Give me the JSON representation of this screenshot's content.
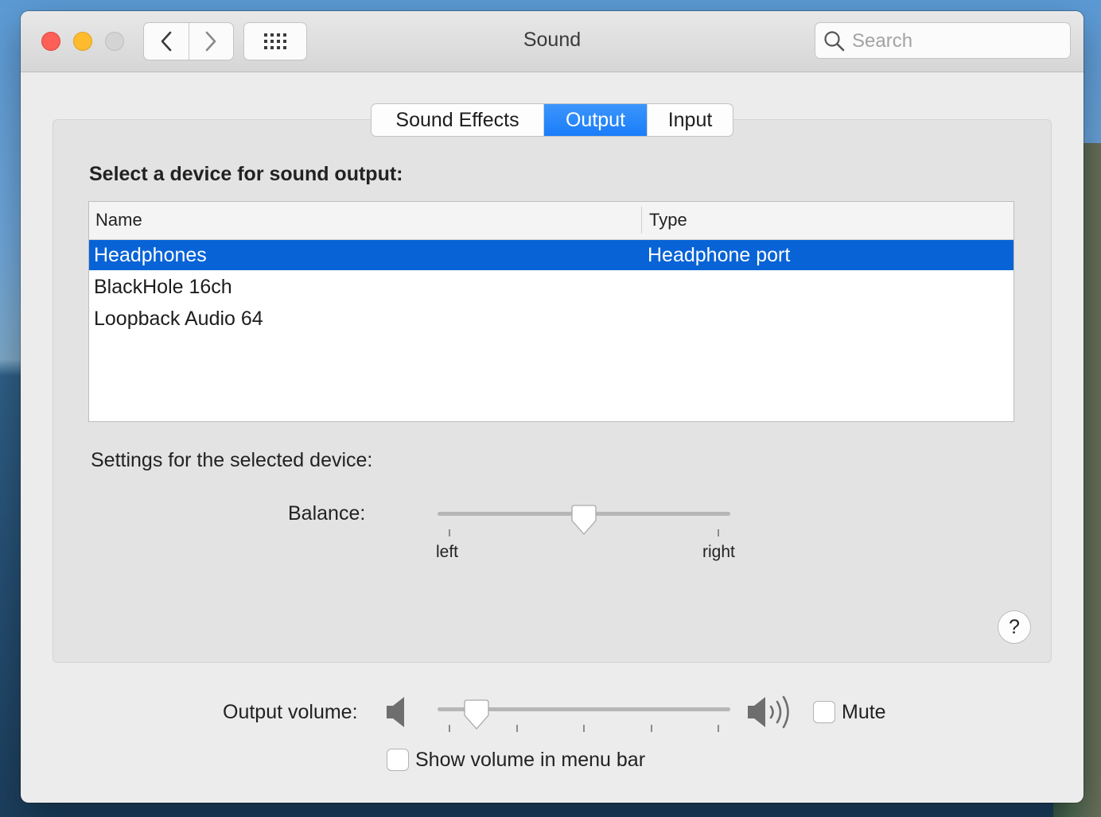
{
  "window": {
    "title": "Sound"
  },
  "toolbar": {
    "search_placeholder": "Search"
  },
  "tabs": [
    {
      "label": "Sound Effects",
      "active": false
    },
    {
      "label": "Output",
      "active": true
    },
    {
      "label": "Input",
      "active": false
    }
  ],
  "output": {
    "section_title": "Select a device for sound output:",
    "columns": [
      "Name",
      "Type"
    ],
    "devices": [
      {
        "name": "Headphones",
        "type": "Headphone port",
        "selected": true
      },
      {
        "name": "BlackHole 16ch",
        "type": "",
        "selected": false
      },
      {
        "name": "Loopback Audio 64",
        "type": "",
        "selected": false
      }
    ],
    "settings_label": "Settings for the selected device:",
    "balance": {
      "label": "Balance:",
      "left_label": "left",
      "right_label": "right",
      "value": 0.5
    }
  },
  "volume": {
    "label": "Output volume:",
    "value": 0.1,
    "mute_label": "Mute",
    "mute_checked": false,
    "menu_bar_label": "Show volume in menu bar",
    "menu_bar_checked": false
  },
  "help": {
    "label": "?"
  },
  "colors": {
    "accent": "#1a7dfa",
    "selection": "#0863d6",
    "close": "#fe5f57",
    "minimize": "#febb2e",
    "zoom_disabled": "#d4d4d4"
  }
}
